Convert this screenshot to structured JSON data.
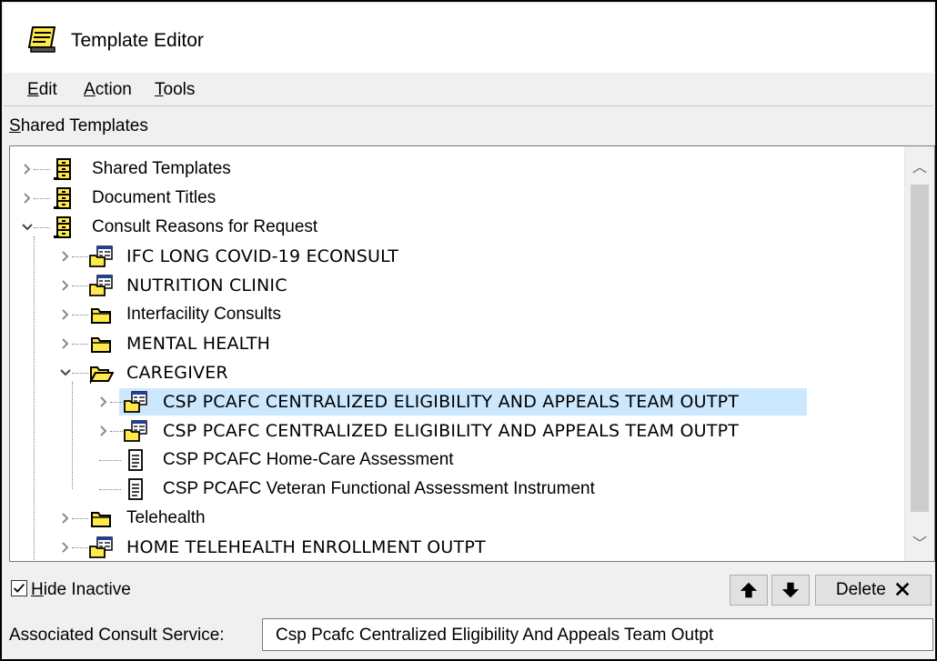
{
  "window": {
    "title": "Template Editor"
  },
  "menu": {
    "items": [
      {
        "label": "Edit",
        "accel": "E",
        "rest": "dit"
      },
      {
        "label": "Action",
        "accel": "A",
        "rest": "ction"
      },
      {
        "label": "Tools",
        "accel": "T",
        "rest": "ools"
      }
    ]
  },
  "section_label": {
    "accel": "S",
    "rest": "hared Templates"
  },
  "tree": {
    "rows": [
      {
        "label": "Shared Templates",
        "expander": "collapsed",
        "icon": "drawer-icon"
      },
      {
        "label": "Document Titles",
        "expander": "collapsed",
        "icon": "drawer-icon"
      },
      {
        "label": "Consult Reasons for Request",
        "expander": "expanded",
        "icon": "drawer-icon"
      },
      {
        "label": "IFC LONG COVID-19 ECONSULT",
        "expander": "collapsed",
        "icon": "folder-dialog-icon"
      },
      {
        "label": "NUTRITION CLINIC",
        "expander": "collapsed",
        "icon": "folder-dialog-icon"
      },
      {
        "label": "Interfacility Consults",
        "expander": "collapsed",
        "icon": "folder-icon"
      },
      {
        "label": "MENTAL HEALTH",
        "expander": "collapsed",
        "icon": "folder-icon"
      },
      {
        "label": "CAREGIVER",
        "expander": "expanded",
        "icon": "open-folder-icon"
      },
      {
        "label": "CSP PCAFC CENTRALIZED ELIGIBILITY AND APPEALS TEAM OUTPT",
        "expander": "collapsed",
        "icon": "folder-dialog-icon",
        "selected": true
      },
      {
        "label": "CSP PCAFC CENTRALIZED ELIGIBILITY AND APPEALS TEAM OUTPT",
        "expander": "collapsed",
        "icon": "folder-dialog-icon"
      },
      {
        "label": "CSP PCAFC Home-Care Assessment",
        "expander": "none",
        "icon": "document-icon"
      },
      {
        "label": "CSP PCAFC Veteran Functional Assessment Instrument",
        "expander": "none",
        "icon": "document-icon"
      },
      {
        "label": "Telehealth",
        "expander": "collapsed",
        "icon": "folder-icon"
      },
      {
        "label": "HOME TELEHEALTH ENROLLMENT OUTPT",
        "expander": "collapsed",
        "icon": "folder-dialog-icon"
      }
    ]
  },
  "hide_inactive": {
    "accel": "H",
    "rest": "ide Inactive",
    "checked": true
  },
  "buttons": {
    "up": "▲",
    "down": "▼",
    "delete": "Delete",
    "delete_glyph": "✕"
  },
  "associated": {
    "label": "Associated Consult Service:",
    "value": "Csp Pcafc Centralized Eligibility And Appeals Team Outpt"
  },
  "colors": {
    "selection": "#cce8ff",
    "icon_yellow": "#ffe84a"
  }
}
